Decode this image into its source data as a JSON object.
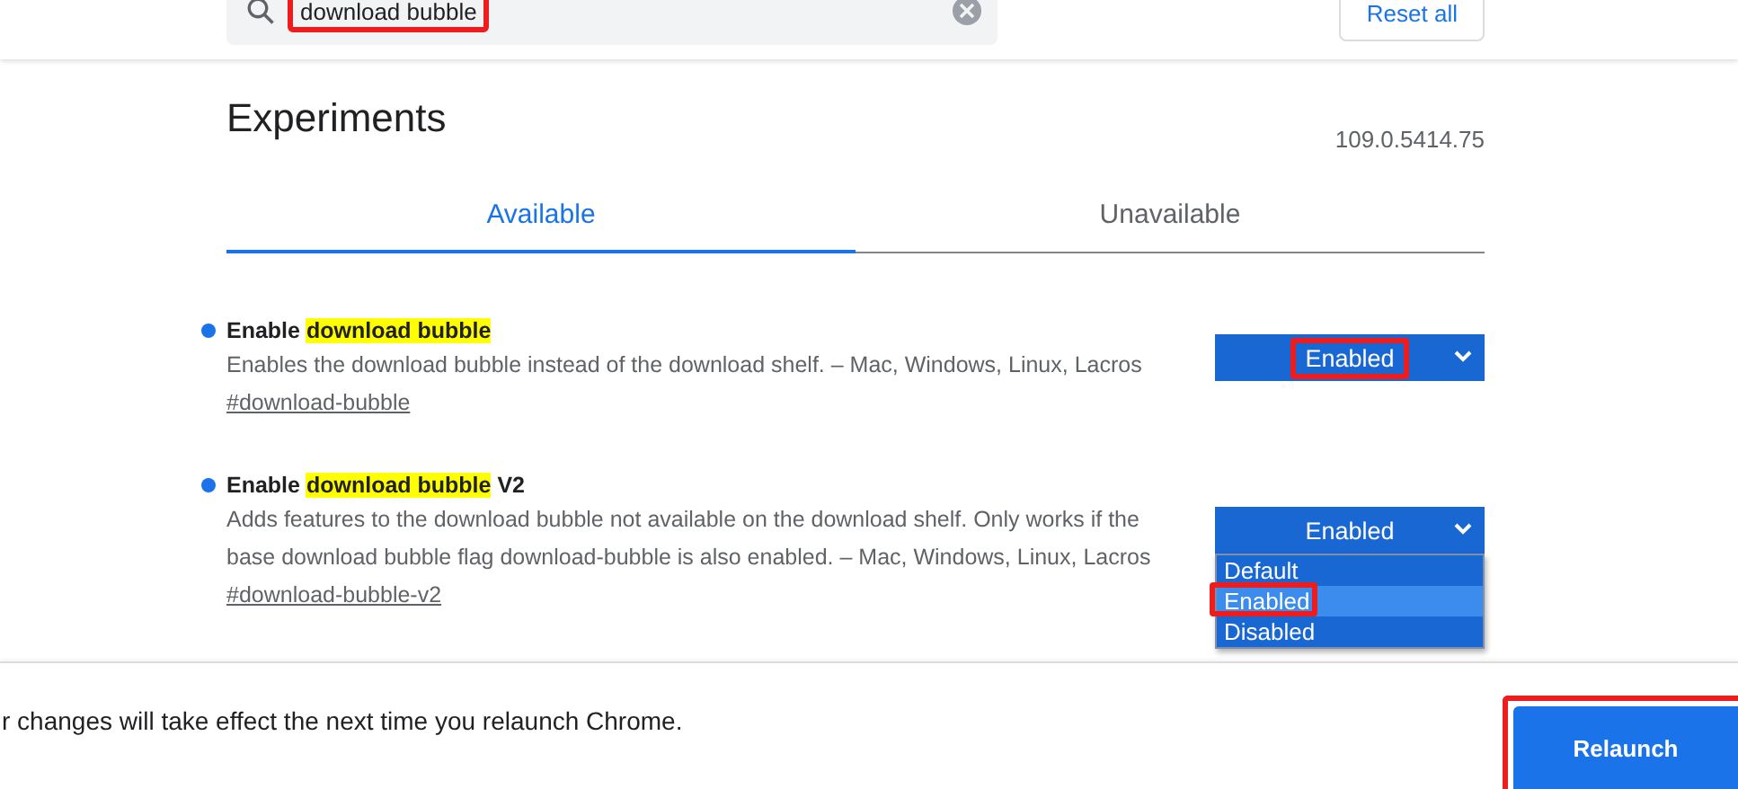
{
  "search": {
    "value": "download bubble",
    "highlighted": true
  },
  "reset_button": "Reset all",
  "title": "Experiments",
  "version": "109.0.5414.75",
  "tabs": [
    {
      "label": "Available",
      "selected": true
    },
    {
      "label": "Unavailable",
      "selected": false
    }
  ],
  "flags": [
    {
      "title": [
        {
          "text": "Enable ",
          "match": false
        },
        {
          "text": "download bubble",
          "match": true
        }
      ],
      "description": "Enables the download bubble instead of the download shelf. – Mac, Windows, Linux, Lacros",
      "link": "#download-bubble",
      "select": {
        "value": "Enabled",
        "highlighted": true,
        "open": false
      }
    },
    {
      "title": [
        {
          "text": "Enable ",
          "match": false
        },
        {
          "text": "download bubble",
          "match": true
        },
        {
          "text": " V2",
          "match": false
        }
      ],
      "description": "Adds features to the download bubble not available on the download shelf. Only works if the base download bubble flag download-bubble is also enabled. – Mac, Windows, Linux, Lacros",
      "link": "#download-bubble-v2",
      "select": {
        "value": "Enabled",
        "highlighted": false,
        "open": true,
        "options": [
          {
            "label": "Default",
            "selected": false,
            "highlighted": false
          },
          {
            "label": "Enabled",
            "selected": true,
            "highlighted": true
          },
          {
            "label": "Disabled",
            "selected": false,
            "highlighted": false
          }
        ]
      }
    }
  ],
  "footer": {
    "message": "r changes will take effect the next time you relaunch Chrome.",
    "button": "Relaunch",
    "button_highlighted": true
  }
}
